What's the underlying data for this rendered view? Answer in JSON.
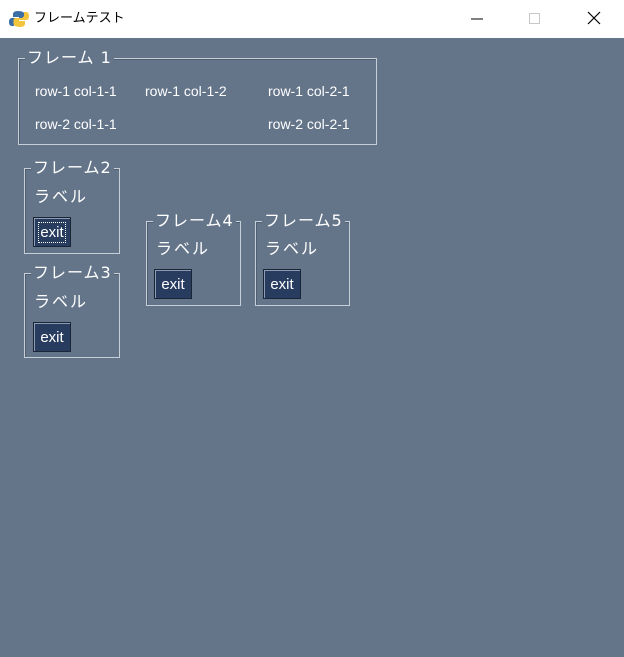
{
  "window": {
    "title": "フレームテスト",
    "icon": "python-icon",
    "controls": {
      "minimize": "minimize-icon",
      "maximize": "maximize-icon",
      "close": "close-icon"
    }
  },
  "colors": {
    "background": "#64758a",
    "button_bg": "#283c5f",
    "text": "#ffffff",
    "titlebar_bg": "#ffffff"
  },
  "frame1": {
    "title": "フレーム 1",
    "cells": {
      "r1c11": "row-1 col-1-1",
      "r1c12": "row-1 col-1-2",
      "r1c21": "row-1 col-2-1",
      "r2c11": "row-2 col-1-1",
      "r2c21": "row-2 col-2-1"
    }
  },
  "frame2": {
    "title": "フレーム2",
    "label": "ラベル",
    "button": "exit"
  },
  "frame3": {
    "title": "フレーム3",
    "label": "ラベル",
    "button": "exit"
  },
  "frame4": {
    "title": "フレーム4",
    "label": "ラベル",
    "button": "exit"
  },
  "frame5": {
    "title": "フレーム5",
    "label": "ラベル",
    "button": "exit"
  }
}
